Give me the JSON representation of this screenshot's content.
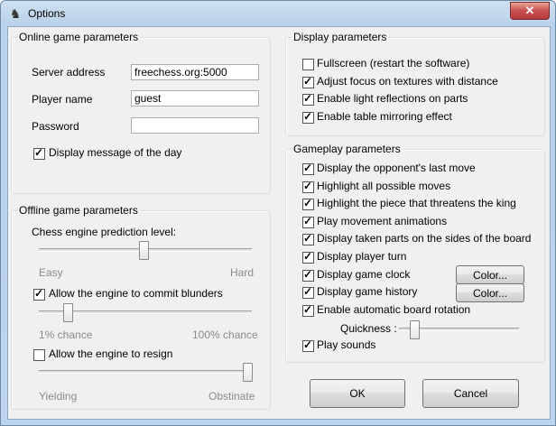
{
  "window": {
    "title": "Options",
    "icon": "chess-knight-icon",
    "close_glyph": "✕"
  },
  "online": {
    "legend": "Online game parameters",
    "server_label": "Server address",
    "server_value": "freechess.org:5000",
    "player_label": "Player name",
    "player_value": "guest",
    "password_label": "Password",
    "password_value": "",
    "motd_label": "Display message of the day",
    "motd_checked": true
  },
  "offline": {
    "legend": "Offline game parameters",
    "prediction_label": "Chess engine prediction level:",
    "prediction_level": 0.49,
    "prediction_min": "Easy",
    "prediction_max": "Hard",
    "blunders_label": "Allow the engine to commit blunders",
    "blunders_checked": true,
    "blunders_level": 0.12,
    "blunders_min": "1% chance",
    "blunders_max": "100% chance",
    "resign_label": "Allow the engine to resign",
    "resign_checked": false,
    "resign_level": 1.0,
    "resign_min": "Yielding",
    "resign_max": "Obstinate"
  },
  "display": {
    "legend": "Display parameters",
    "items": [
      {
        "label": "Fullscreen (restart the software)",
        "checked": false
      },
      {
        "label": "Adjust focus on textures with distance",
        "checked": true
      },
      {
        "label": "Enable light reflections on parts",
        "checked": true
      },
      {
        "label": "Enable table mirroring effect",
        "checked": true
      }
    ]
  },
  "gameplay": {
    "legend": "Gameplay parameters",
    "items": [
      {
        "label": "Display the opponent's last move",
        "checked": true
      },
      {
        "label": "Highlight all possible moves",
        "checked": true
      },
      {
        "label": "Highlight the piece that threatens the king",
        "checked": true
      },
      {
        "label": "Play movement animations",
        "checked": true
      },
      {
        "label": "Display taken parts on the sides of the board",
        "checked": true
      },
      {
        "label": "Display player turn",
        "checked": true
      },
      {
        "label": "Display game clock",
        "checked": true
      },
      {
        "label": "Display game history",
        "checked": true
      },
      {
        "label": "Enable automatic board rotation",
        "checked": true
      }
    ],
    "clock_color_button": "Color...",
    "history_color_button": "Color...",
    "quickness_label": "Quickness :",
    "quickness_level": 0.1,
    "sounds_label": "Play sounds",
    "sounds_checked": true
  },
  "buttons": {
    "ok": "OK",
    "cancel": "Cancel"
  }
}
